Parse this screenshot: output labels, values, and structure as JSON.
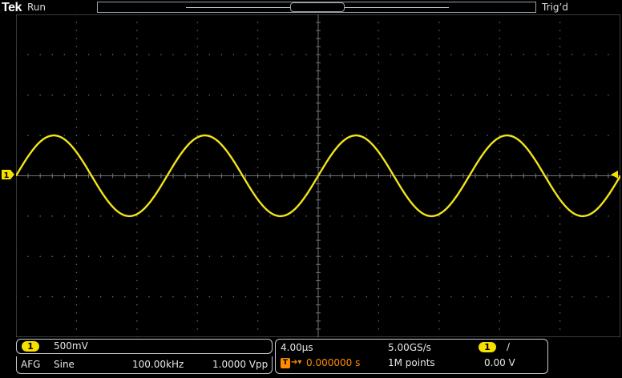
{
  "top_bar": {
    "brand": "Tek",
    "run_status": "Run",
    "trigger_state": "Trig’d"
  },
  "markers": {
    "channel_marker": "1",
    "trigger_position_marker": "T"
  },
  "waveform": {
    "color": "#f2e41a",
    "cycles_visible": 4
  },
  "channel_panel": {
    "channel_badge": "1",
    "scale": "500mV"
  },
  "afg_panel": {
    "label": "AFG",
    "function": "Sine",
    "frequency": "100.00kHz",
    "amplitude": "1.0000 Vpp"
  },
  "timebase_panel": {
    "horizontal_scale": "4.00µs",
    "sample_rate": "5.00GS/s",
    "trigger_source_badge": "1",
    "trigger_slope": "∕",
    "trigger_position_icon": "T",
    "trigger_delay": "0.000000 s",
    "record_length": "1M points",
    "trigger_level": "0.00 V"
  },
  "colors": {
    "background": "#000000",
    "channel1": "#f5e000",
    "trigger": "#ff8c00",
    "grid": "#6e7378"
  }
}
